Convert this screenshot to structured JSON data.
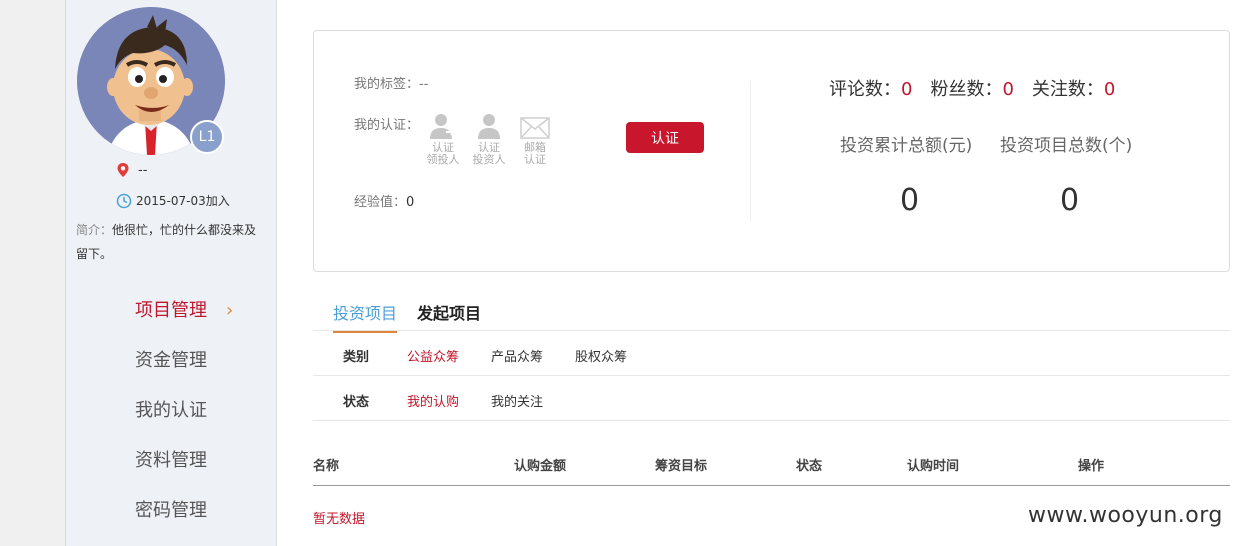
{
  "sidebar": {
    "level": "L1",
    "location": "--",
    "join_date": "2015-07-03加入",
    "bio_label": "简介：",
    "bio_text": "他很忙，忙的什么都没来及留下。",
    "nav": [
      {
        "label": "项目管理",
        "active": true
      },
      {
        "label": "资金管理",
        "active": false
      },
      {
        "label": "我的认证",
        "active": false
      },
      {
        "label": "资料管理",
        "active": false
      },
      {
        "label": "密码管理",
        "active": false
      }
    ],
    "chevron": "›"
  },
  "profile": {
    "tag_label": "我的标签：",
    "tag_value": "--",
    "cert_label": "我的认证：",
    "cert_items": [
      {
        "icon": "person-arrow-icon",
        "line1": "认证",
        "line2": "领投人"
      },
      {
        "icon": "person-icon",
        "line1": "认证",
        "line2": "投资人"
      },
      {
        "icon": "mail-icon",
        "line1": "邮箱",
        "line2": "认证"
      }
    ],
    "exp_label": "经验值：",
    "exp_value": "0",
    "verify_button": "认证",
    "stats": [
      {
        "label": "评论数：",
        "value": "0"
      },
      {
        "label": "粉丝数：",
        "value": "0"
      },
      {
        "label": "关注数：",
        "value": "0"
      }
    ],
    "total_amount_label": "投资累计总额(元)",
    "total_count_label": "投资项目总数(个)",
    "total_amount": "0",
    "total_count": "0"
  },
  "tabs": [
    "投资项目",
    "发起项目"
  ],
  "filters": {
    "category_label": "类别",
    "categories": [
      "公益众筹",
      "产品众筹",
      "股权众筹"
    ],
    "status_label": "状态",
    "statuses": [
      "我的认购",
      "我的关注"
    ]
  },
  "table": {
    "columns": [
      "名称",
      "认购金额",
      "筹资目标",
      "状态",
      "认购时间",
      "操作"
    ],
    "empty_text": "暂无数据"
  },
  "watermark": "www.wooyun.org",
  "colors": {
    "accent": "#c0172c",
    "tab_active": "#4a9fd8",
    "chevron": "#e0863c"
  }
}
